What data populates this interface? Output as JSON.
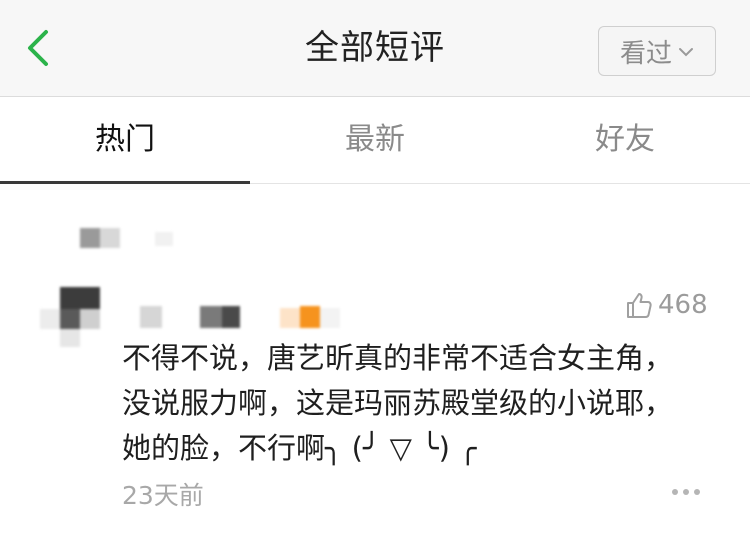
{
  "header": {
    "title": "全部短评",
    "seen_label": "看过"
  },
  "tabs": [
    {
      "label": "热门",
      "active": true
    },
    {
      "label": "最新",
      "active": false
    },
    {
      "label": "好友",
      "active": false
    }
  ],
  "comment": {
    "likes": "468",
    "text": "不得不说，唐艺昕真的非常不适合女主角，\n没说服力啊，这是玛丽苏殿堂级的小说耶，\n她的脸，不行啊╮ (╯ ▽ ╰) ╭",
    "time": "23天前"
  },
  "colors": {
    "accent_green": "#2bb34a",
    "text_primary": "#1f1f1f",
    "text_muted": "#a8a8a8"
  }
}
